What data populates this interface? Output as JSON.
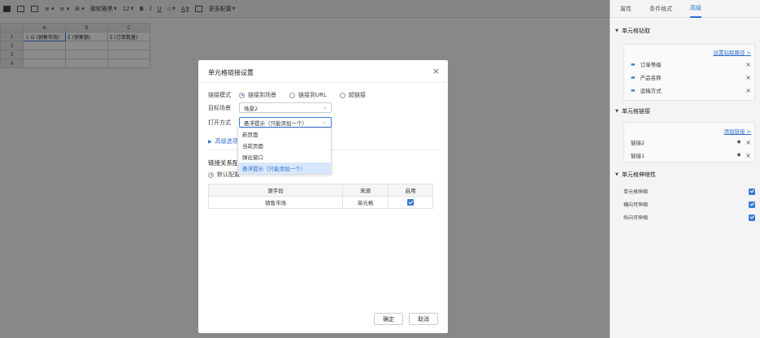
{
  "toolbar": {
    "items": [
      "≡ ▾",
      "≡ ▾",
      "⊞ ▾"
    ],
    "number_format": "微软雅黑",
    "font_size": "12",
    "bold": "B",
    "italic": "I",
    "underline": "U",
    "fill": "◇",
    "font_color": "A",
    "more_config": "更多配置"
  },
  "sheet": {
    "columns": [
      "A",
      "B",
      "C"
    ],
    "rows": [
      "1",
      "2",
      "3",
      "4"
    ],
    "row1": [
      "⇂ G (销售市场)",
      "Σ (销售额)",
      "Σ (订单数量)"
    ]
  },
  "dialog": {
    "title": "单元格链接设置",
    "close": "×",
    "link_mode_label": "链接模式",
    "link_modes": [
      "链接到场景",
      "链接到URL",
      "超链接"
    ],
    "target_label": "目标场景",
    "target_value": "场景2",
    "open_label": "打开方式",
    "open_value": "悬浮提示（只能添加一个）",
    "advanced": "高级选项",
    "relation_title": "链接关系配置",
    "default_config": "默认配置",
    "table": {
      "headers": [
        "源字段",
        "来源",
        "启用"
      ],
      "rows": [
        [
          "销售市场",
          "单元格"
        ]
      ]
    },
    "ok": "确定",
    "cancel": "取消"
  },
  "dropdown": {
    "options": [
      "新页面",
      "当前页面",
      "弹出窗口",
      "悬浮提示（只能添加一个）"
    ],
    "selected_index": 3
  },
  "panel": {
    "tabs": [
      "属性",
      "条件格式",
      "高级"
    ],
    "active_tab": 2,
    "drill": {
      "title": "单元格钻取",
      "link": "设置钻取路径",
      "items": [
        "订单等级",
        "产品名称",
        "运输方式"
      ]
    },
    "cell_link": {
      "title": "单元格链接",
      "link": "添加链接",
      "items": [
        "链接2",
        "链接1"
      ]
    },
    "stretch": {
      "title": "单元格伸缩性",
      "items": [
        "单元格伸缩",
        "横向可伸缩",
        "纵向可伸缩"
      ]
    }
  },
  "colors": {
    "accent": "#2f6fd1",
    "overlay": "rgba(0,0,0,0.45)"
  }
}
